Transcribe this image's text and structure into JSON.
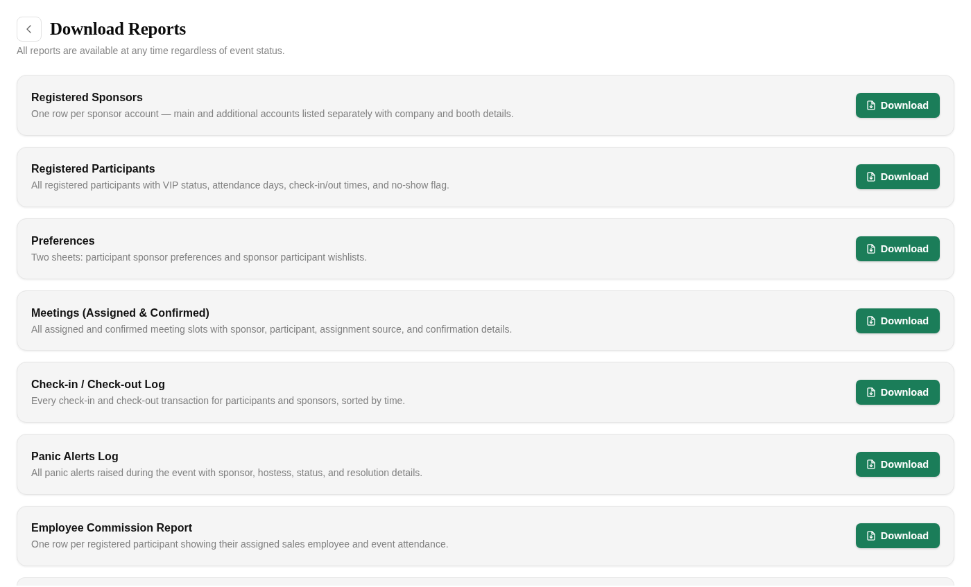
{
  "header": {
    "title": "Download Reports",
    "subtitle": "All reports are available at any time regardless of event status."
  },
  "reports": [
    {
      "title": "Registered Sponsors",
      "description": "One row per sponsor account — main and additional accounts listed separately with company and booth details.",
      "button": "Download"
    },
    {
      "title": "Registered Participants",
      "description": "All registered participants with VIP status, attendance days, check-in/out times, and no-show flag.",
      "button": "Download"
    },
    {
      "title": "Preferences",
      "description": "Two sheets: participant sponsor preferences and sponsor participant wishlists.",
      "button": "Download"
    },
    {
      "title": "Meetings (Assigned & Confirmed)",
      "description": "All assigned and confirmed meeting slots with sponsor, participant, assignment source, and confirmation details.",
      "button": "Download"
    },
    {
      "title": "Check-in / Check-out Log",
      "description": "Every check-in and check-out transaction for participants and sponsors, sorted by time.",
      "button": "Download"
    },
    {
      "title": "Panic Alerts Log",
      "description": "All panic alerts raised during the event with sponsor, hostess, status, and resolution details.",
      "button": "Download"
    },
    {
      "title": "Employee Commission Report",
      "description": "One row per registered participant showing their assigned sales employee and event attendance.",
      "button": "Download"
    }
  ]
}
